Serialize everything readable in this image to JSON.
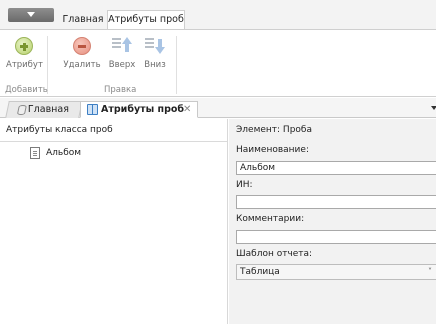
{
  "ribbon": {
    "tabs": [
      {
        "label": "Главная"
      },
      {
        "label": "Атрибуты проб"
      }
    ],
    "buttons": {
      "add": "Атрибут",
      "delete": "Удалить",
      "up": "Вверх",
      "down": "Вниз"
    },
    "groups": {
      "add": "Добавить",
      "edit": "Правка"
    }
  },
  "doc_tabs": [
    {
      "label": "Главная"
    },
    {
      "label": "Атрибуты проб"
    }
  ],
  "left_panel": {
    "title": "Атрибуты класса проб",
    "items": [
      {
        "label": "Альбом"
      }
    ]
  },
  "right_panel": {
    "title": "Элемент: Проба",
    "name_label": "Наименование:",
    "name_value": "Альбом",
    "id_label": "ИН:",
    "id_value": "",
    "comment_label": "Комментарии:",
    "comment_value": "",
    "template_label": "Шаблон отчета:",
    "template_value": "Таблица"
  },
  "colors": {
    "add_icon": "#b6d06a",
    "delete_icon": "#e79080",
    "arrow_icon": "#a9c4e4",
    "right_panel_bg": "#f2f2f2"
  }
}
